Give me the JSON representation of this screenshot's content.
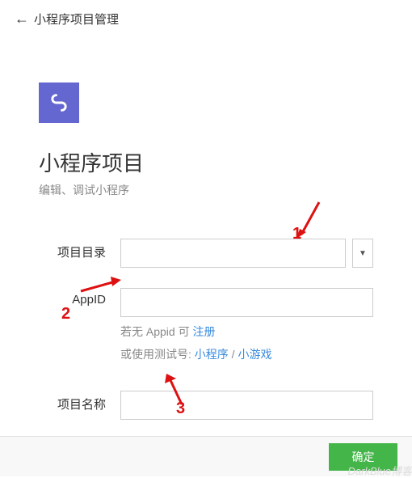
{
  "header": {
    "title": "小程序项目管理"
  },
  "page": {
    "title": "小程序项目",
    "subtitle": "编辑、调试小程序"
  },
  "form": {
    "dir_label": "项目目录",
    "dir_value": "",
    "appid_label": "AppID",
    "appid_value": "",
    "appid_hint_prefix": "若无 Appid 可 ",
    "appid_register": "注册",
    "appid_test_prefix": "或使用测试号: ",
    "appid_test_mp": "小程序",
    "appid_test_game": "小游戏",
    "name_label": "项目名称",
    "name_value": ""
  },
  "footer": {
    "confirm": "确定"
  },
  "annotations": {
    "a1": "1",
    "a2": "2",
    "a3": "3"
  },
  "watermark": "DarkBlue博客"
}
